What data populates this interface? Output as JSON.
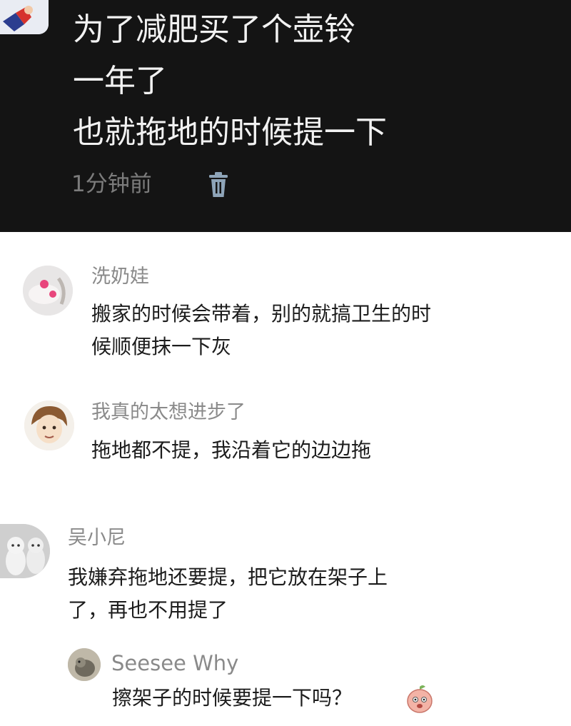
{
  "post": {
    "lines": [
      "为了减肥买了个壶铃",
      "一年了",
      "也就拖地的时候提一下"
    ],
    "time": "1分钟前"
  },
  "comments": [
    {
      "name": "洗奶娃",
      "lines": [
        "搬家的时候会带着，别的就搞卫生的时",
        "候顺便抹一下灰"
      ]
    },
    {
      "name": "我真的太想进步了",
      "lines": [
        "拖地都不提，我沿着它的边边拖"
      ]
    },
    {
      "name": "吴小尼",
      "lines": [
        "我嫌弃拖地还要提，把它放在架子上",
        "了，再也不用提了"
      ]
    }
  ],
  "reply": {
    "name": "Seesee Why",
    "text": "擦架子的时候要提一下吗？"
  },
  "icons": {
    "delete": "trash-icon",
    "sticker": "peach-face-sticker"
  }
}
